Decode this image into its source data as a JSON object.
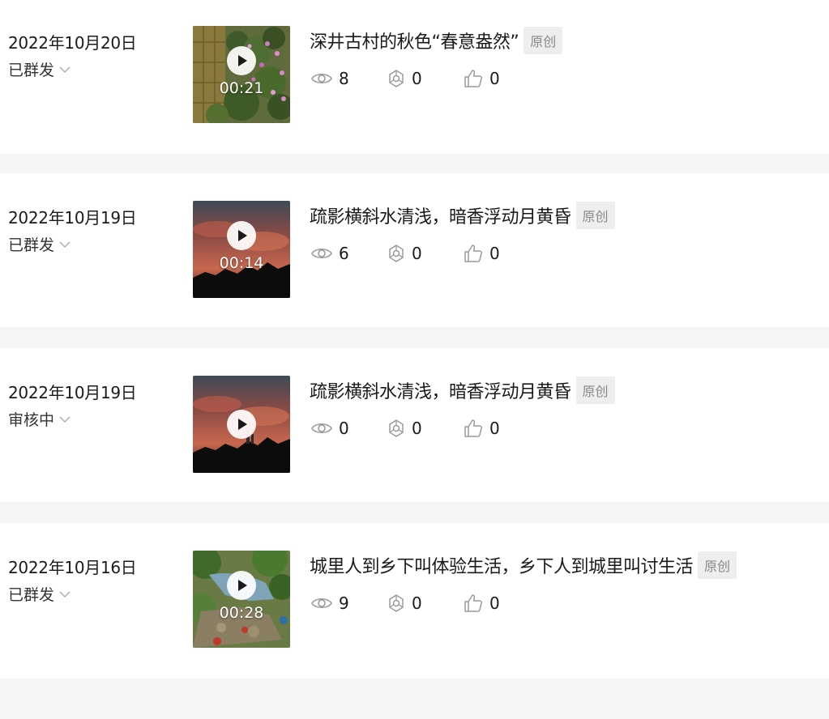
{
  "items": [
    {
      "date": "2022年10月20日",
      "status": "已群发",
      "duration": "00:21",
      "title": "深井古村的秋色“春意盎然”",
      "tag": "原创",
      "views": "8",
      "shares": "0",
      "likes": "0"
    },
    {
      "date": "2022年10月19日",
      "status": "已群发",
      "duration": "00:14",
      "title": "疏影横斜水清浅，暗香浮动月黄昏",
      "tag": "原创",
      "views": "6",
      "shares": "0",
      "likes": "0"
    },
    {
      "date": "2022年10月19日",
      "status": "审核中",
      "duration": "",
      "title": "疏影横斜水清浅，暗香浮动月黄昏",
      "tag": "原创",
      "views": "0",
      "shares": "0",
      "likes": "0"
    },
    {
      "date": "2022年10月16日",
      "status": "已群发",
      "duration": "00:28",
      "title": "城里人到乡下叫体验生活，乡下人到城里叫讨生活",
      "tag": "原创",
      "views": "9",
      "shares": "0",
      "likes": "0"
    }
  ],
  "icons": {
    "status_toggle": "chevron-down-icon",
    "play": "play-icon",
    "views": "eye-icon",
    "shares": "share-icon",
    "likes": "thumbs-up-icon"
  },
  "colors": {
    "page_bg": "#f4f5f7",
    "card_bg": "#ffffff",
    "tag_bg": "#eeeeee",
    "tag_text": "#888888",
    "icon": "#9a9a9a"
  }
}
